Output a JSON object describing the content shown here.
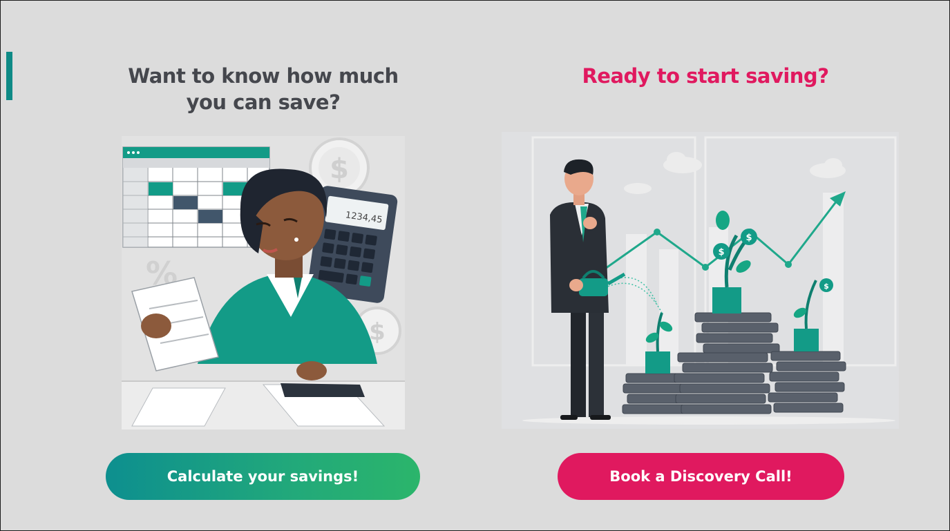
{
  "left_panel": {
    "heading": "Want to know how much you can save?",
    "button_label": "Calculate your savings!",
    "illustration_calculator_display": "1234,45"
  },
  "right_panel": {
    "heading": "Ready to start saving?",
    "button_label": "Book a Discovery Call!"
  },
  "colors": {
    "background": "#dcdcdc",
    "accent_teal": "#0e8a86",
    "button_green_start": "#0d8f8f",
    "button_green_end": "#2bb56b",
    "brand_pink": "#e0195f",
    "heading_gray": "#45474d"
  }
}
